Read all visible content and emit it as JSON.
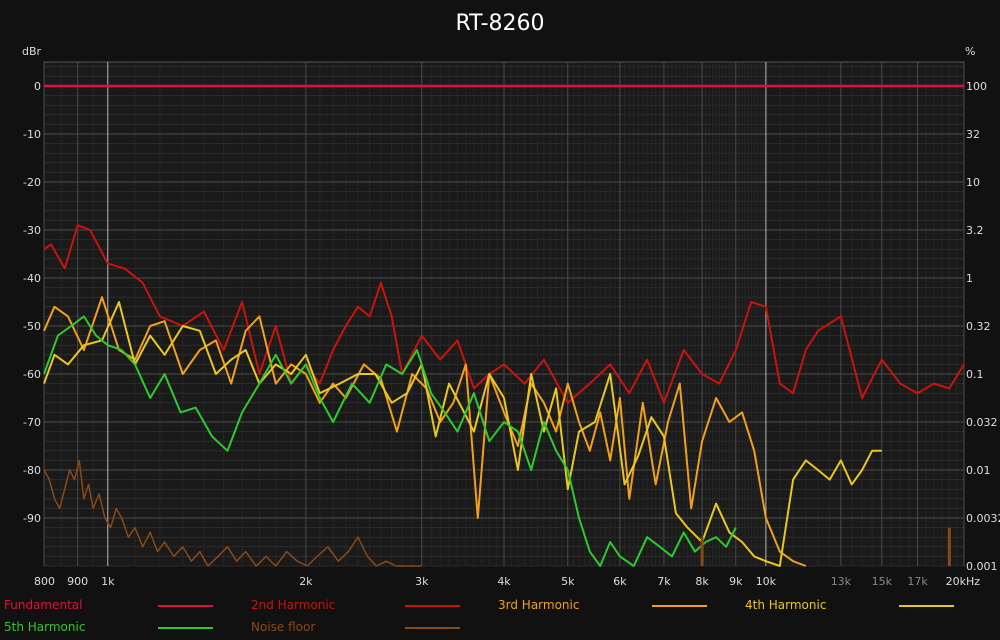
{
  "chart_data": {
    "type": "line",
    "title": "RT-8260",
    "ylabel_left": "dBr",
    "ylabel_right": "%",
    "x_scale": "log",
    "x_unit": "kHz",
    "xlim": [
      800,
      20000
    ],
    "ylim": [
      -100,
      5
    ],
    "x_ticks": [
      {
        "v": 800,
        "label": "800",
        "dim": false
      },
      {
        "v": 900,
        "label": "900",
        "dim": false
      },
      {
        "v": 1000,
        "label": "1k",
        "dim": false
      },
      {
        "v": 2000,
        "label": "2k",
        "dim": false
      },
      {
        "v": 3000,
        "label": "3k",
        "dim": false
      },
      {
        "v": 4000,
        "label": "4k",
        "dim": false
      },
      {
        "v": 5000,
        "label": "5k",
        "dim": false
      },
      {
        "v": 6000,
        "label": "6k",
        "dim": false
      },
      {
        "v": 7000,
        "label": "7k",
        "dim": false
      },
      {
        "v": 8000,
        "label": "8k",
        "dim": false
      },
      {
        "v": 9000,
        "label": "9k",
        "dim": false
      },
      {
        "v": 10000,
        "label": "10k",
        "dim": false
      },
      {
        "v": 13000,
        "label": "13k",
        "dim": true
      },
      {
        "v": 15000,
        "label": "15k",
        "dim": true
      },
      {
        "v": 17000,
        "label": "17k",
        "dim": true
      },
      {
        "v": 20000,
        "label": "20kHz",
        "dim": false
      }
    ],
    "y_ticks_left": [
      {
        "v": 0,
        "label": "0"
      },
      {
        "v": -10,
        "label": "-10"
      },
      {
        "v": -20,
        "label": "-20"
      },
      {
        "v": -30,
        "label": "-30"
      },
      {
        "v": -40,
        "label": "-40"
      },
      {
        "v": -50,
        "label": "-50"
      },
      {
        "v": -60,
        "label": "-60"
      },
      {
        "v": -70,
        "label": "-70"
      },
      {
        "v": -80,
        "label": "-80"
      },
      {
        "v": -90,
        "label": "-90"
      }
    ],
    "y_ticks_right": [
      {
        "v": 0,
        "label": "100"
      },
      {
        "v": -10,
        "label": "32"
      },
      {
        "v": -20,
        "label": "10"
      },
      {
        "v": -30,
        "label": "3.2"
      },
      {
        "v": -40,
        "label": "1"
      },
      {
        "v": -50,
        "label": "0.32"
      },
      {
        "v": -60,
        "label": "0.1"
      },
      {
        "v": -70,
        "label": "0.032"
      },
      {
        "v": -80,
        "label": "0.01"
      },
      {
        "v": -90,
        "label": "0.0032"
      },
      {
        "v": -100,
        "label": "0.001"
      }
    ],
    "grid": true,
    "legend_position": "bottom",
    "series": [
      {
        "name": "Fundamental",
        "color": "#e0103a",
        "width": 2.5,
        "x": [
          800,
          20000
        ],
        "y": [
          0,
          0
        ]
      },
      {
        "name": "2nd Harmonic",
        "color": "#c8140c",
        "width": 2,
        "x": [
          800,
          820,
          860,
          900,
          940,
          1000,
          1060,
          1130,
          1200,
          1300,
          1400,
          1500,
          1600,
          1700,
          1800,
          1900,
          2000,
          2100,
          2200,
          2300,
          2400,
          2500,
          2600,
          2700,
          2800,
          3000,
          3200,
          3400,
          3600,
          3800,
          4000,
          4300,
          4600,
          5000,
          5400,
          5800,
          6200,
          6600,
          7000,
          7500,
          8000,
          8500,
          9000,
          9500,
          10000,
          10500,
          11000,
          11500,
          12000,
          13000,
          14000,
          15000,
          16000,
          17000,
          18000,
          19000,
          20000
        ],
        "y": [
          -34,
          -33,
          -38,
          -29,
          -30,
          -37,
          -38,
          -41,
          -48,
          -50,
          -47,
          -55,
          -45,
          -60,
          -50,
          -62,
          -58,
          -62,
          -55,
          -50,
          -46,
          -48,
          -41,
          -48,
          -60,
          -52,
          -57,
          -53,
          -63,
          -60,
          -58,
          -62,
          -57,
          -66,
          -62,
          -58,
          -64,
          -57,
          -66,
          -55,
          -60,
          -62,
          -55,
          -45,
          -46,
          -62,
          -64,
          -55,
          -51,
          -48,
          -65,
          -57,
          -62,
          -64,
          -62,
          -63,
          -58
        ]
      },
      {
        "name": "3rd Harmonic",
        "color": "#f0a01c",
        "width": 2,
        "x": [
          800,
          830,
          870,
          920,
          980,
          1040,
          1100,
          1160,
          1220,
          1300,
          1380,
          1460,
          1540,
          1620,
          1700,
          1800,
          1900,
          2000,
          2100,
          2200,
          2300,
          2450,
          2600,
          2750,
          2900,
          3050,
          3200,
          3350,
          3500,
          3650,
          3800,
          4000,
          4200,
          4400,
          4600,
          4800,
          5000,
          5200,
          5400,
          5600,
          5800,
          6000,
          6200,
          6500,
          6800,
          7100,
          7400,
          7700,
          8000,
          8400,
          8800,
          9200,
          9600,
          10000,
          10500,
          11000,
          11500
        ],
        "y": [
          -51,
          -46,
          -48,
          -55,
          -44,
          -55,
          -57,
          -50,
          -49,
          -60,
          -55,
          -53,
          -62,
          -51,
          -48,
          -62,
          -58,
          -60,
          -66,
          -62,
          -65,
          -58,
          -61,
          -72,
          -60,
          -63,
          -70,
          -66,
          -58,
          -90,
          -60,
          -68,
          -75,
          -62,
          -66,
          -72,
          -62,
          -70,
          -76,
          -68,
          -78,
          -65,
          -86,
          -66,
          -83,
          -70,
          -62,
          -88,
          -74,
          -65,
          -70,
          -68,
          -76,
          -90,
          -97,
          -99,
          -100
        ]
      },
      {
        "name": "4th Harmonic",
        "color": "#e8c820",
        "width": 2,
        "x": [
          800,
          830,
          870,
          920,
          980,
          1040,
          1100,
          1160,
          1220,
          1300,
          1380,
          1460,
          1540,
          1620,
          1700,
          1800,
          1900,
          2000,
          2100,
          2250,
          2400,
          2550,
          2700,
          2850,
          3000,
          3150,
          3300,
          3450,
          3600,
          3800,
          4000,
          4200,
          4400,
          4600,
          4800,
          5000,
          5200,
          5500,
          5800,
          6100,
          6400,
          6700,
          7000,
          7300,
          7600,
          8000,
          8400,
          8800,
          9200,
          9600,
          10000,
          10500,
          11000,
          11500,
          12000,
          12500,
          13000,
          13500,
          14000,
          14500,
          15000
        ],
        "y": [
          -62,
          -56,
          -58,
          -54,
          -53,
          -45,
          -58,
          -52,
          -56,
          -50,
          -51,
          -60,
          -57,
          -55,
          -62,
          -58,
          -60,
          -56,
          -64,
          -62,
          -60,
          -60,
          -66,
          -64,
          -58,
          -73,
          -62,
          -67,
          -72,
          -60,
          -65,
          -80,
          -60,
          -72,
          -63,
          -84,
          -72,
          -70,
          -60,
          -83,
          -77,
          -69,
          -73,
          -89,
          -92,
          -95,
          -87,
          -93,
          -95,
          -98,
          -99,
          -100,
          -82,
          -78,
          -80,
          -82,
          -78,
          -83,
          -80,
          -76,
          -76
        ]
      },
      {
        "name": "5th Harmonic",
        "color": "#30c830",
        "width": 2,
        "x": [
          800,
          840,
          880,
          920,
          960,
          1000,
          1050,
          1100,
          1160,
          1220,
          1290,
          1360,
          1440,
          1520,
          1600,
          1700,
          1800,
          1900,
          2000,
          2100,
          2200,
          2350,
          2500,
          2650,
          2800,
          2950,
          3100,
          3250,
          3400,
          3600,
          3800,
          4000,
          4200,
          4400,
          4600,
          4800,
          5000,
          5200,
          5400,
          5600,
          5800,
          6000,
          6300,
          6600,
          6900,
          7200,
          7500,
          7800,
          8100,
          8400,
          8700,
          9000
        ],
        "y": [
          -60,
          -52,
          -50,
          -48,
          -52,
          -54,
          -55,
          -58,
          -65,
          -60,
          -68,
          -67,
          -73,
          -76,
          -68,
          -62,
          -56,
          -62,
          -58,
          -65,
          -70,
          -62,
          -66,
          -58,
          -60,
          -55,
          -64,
          -68,
          -72,
          -64,
          -74,
          -70,
          -72,
          -80,
          -70,
          -76,
          -80,
          -90,
          -97,
          -100,
          -95,
          -98,
          -100,
          -94,
          -96,
          -98,
          -93,
          -97,
          -95,
          -94,
          -96,
          -92
        ]
      },
      {
        "name": "Noise floor",
        "color": "#8a4a18",
        "width": 1.5,
        "x": [
          800,
          815,
          830,
          845,
          860,
          875,
          890,
          905,
          920,
          935,
          950,
          970,
          990,
          1010,
          1030,
          1050,
          1075,
          1100,
          1130,
          1160,
          1190,
          1220,
          1260,
          1300,
          1340,
          1380,
          1420,
          1470,
          1520,
          1570,
          1620,
          1680,
          1740,
          1800,
          1870,
          1940,
          2010,
          2080,
          2160,
          2240,
          2320,
          2400,
          2480,
          2560,
          2650,
          2740,
          2830,
          2920,
          3000
        ],
        "y": [
          -80,
          -82,
          -86,
          -88,
          -84,
          -80,
          -82,
          -78,
          -86,
          -83,
          -88,
          -85,
          -90,
          -92,
          -88,
          -90,
          -94,
          -92,
          -96,
          -93,
          -97,
          -95,
          -98,
          -96,
          -99,
          -97,
          -100,
          -98,
          -96,
          -99,
          -97,
          -100,
          -98,
          -100,
          -97,
          -99,
          -100,
          -98,
          -96,
          -99,
          -97,
          -94,
          -98,
          -100,
          -99,
          -100,
          -100,
          -100,
          -100
        ]
      }
    ],
    "noise_spikes": [
      {
        "x": 8000,
        "y": -94
      },
      {
        "x": 19000,
        "y": -92
      }
    ]
  },
  "legend": {
    "items": [
      {
        "label": "Fundamental",
        "color": "#e0103a"
      },
      {
        "label": "2nd Harmonic",
        "color": "#c8140c"
      },
      {
        "label": "3rd Harmonic",
        "color": "#f0a01c"
      },
      {
        "label": "4th Harmonic",
        "color": "#e8c820"
      },
      {
        "label": "5th Harmonic",
        "color": "#30c830"
      },
      {
        "label": "Noise floor",
        "color": "#8a4a18"
      }
    ]
  }
}
